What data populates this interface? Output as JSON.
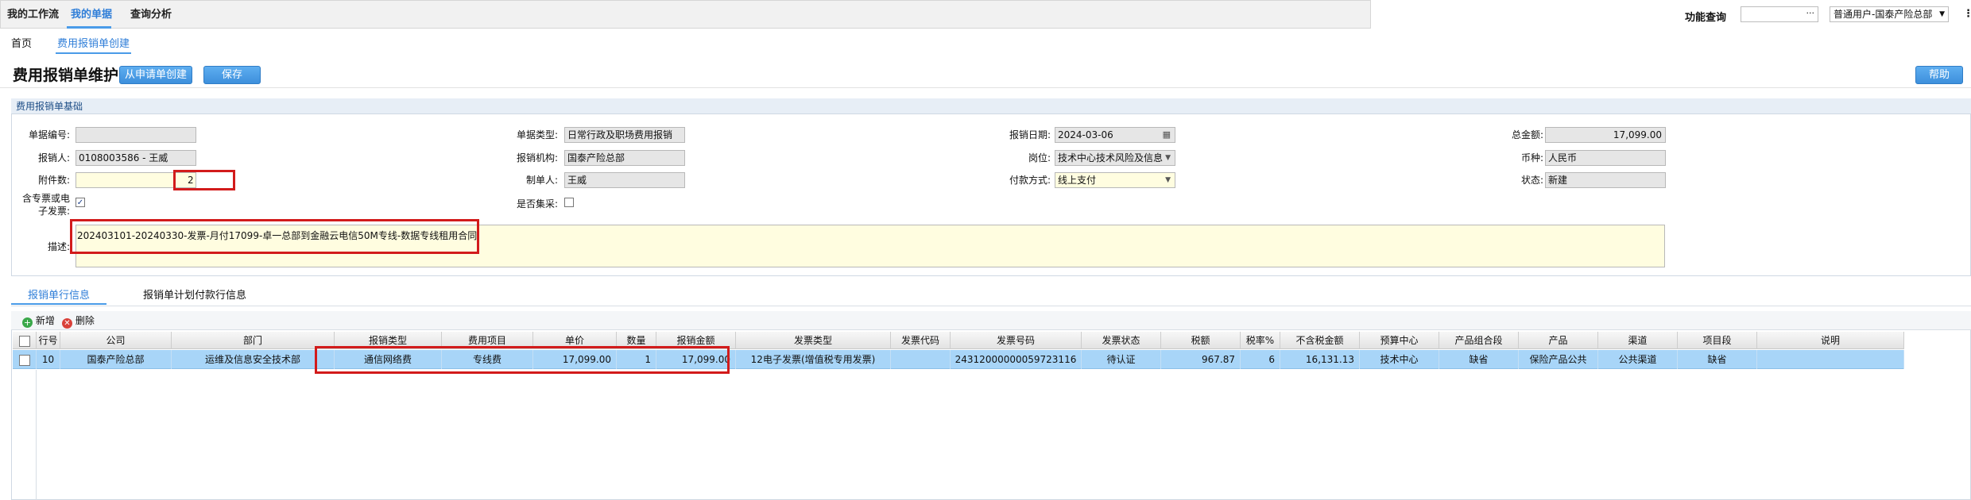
{
  "topnav": {
    "items": [
      "我的工作流",
      "我的单据",
      "查询分析"
    ],
    "function_query": "功能查询",
    "search_value": "···",
    "user_select": "普通用户-国泰产险总部",
    "more": "⋮"
  },
  "breadcrumb_tabs": [
    "首页",
    "费用报销单创建"
  ],
  "header": {
    "title": "费用报销单维护",
    "btn_from_request": "从申请单创建",
    "btn_save": "保存",
    "btn_help": "帮助"
  },
  "panel": {
    "title": "费用报销单基础",
    "fields": {
      "doc_no": {
        "label": "单据编号:",
        "value": ""
      },
      "doc_type": {
        "label": "单据类型:",
        "value": "日常行政及职场费用报销"
      },
      "report_date": {
        "label": "报销日期:",
        "value": "2024-03-06"
      },
      "total": {
        "label": "总金额:",
        "value": "17,099.00"
      },
      "reporter": {
        "label": "报销人:",
        "value": "0108003586 - 王威"
      },
      "org": {
        "label": "报销机构:",
        "value": "国泰产险总部"
      },
      "post": {
        "label": "岗位:",
        "value": "技术中心技术风险及信息"
      },
      "currency": {
        "label": "币种:",
        "value": "人民币"
      },
      "attachments": {
        "label": "附件数:",
        "value": "2"
      },
      "maker": {
        "label": "制单人:",
        "value": "王威"
      },
      "pay_method": {
        "label": "付款方式:",
        "value": "线上支付"
      },
      "status": {
        "label": "状态:",
        "value": "新建"
      },
      "e_invoice": {
        "label": "含专票或电子发票:",
        "checked": true
      },
      "centralized": {
        "label": "是否集采:",
        "checked": false
      },
      "description": {
        "label": "描述:",
        "value": "202403101-20240330-发票-月付17099-卓一总部到金融云电信50M专线-数据专线租用合同"
      }
    }
  },
  "bottom_tabs": [
    "报销单行信息",
    "报销单计划付款行信息"
  ],
  "toolbar": {
    "add": "新增",
    "delete": "删除"
  },
  "grid": {
    "columns": [
      "行号",
      "公司",
      "部门",
      "报销类型",
      "费用项目",
      "单价",
      "数量",
      "报销金额",
      "发票类型",
      "发票代码",
      "发票号码",
      "发票状态",
      "税额",
      "税率%",
      "不含税金额",
      "预算中心",
      "产品组合段",
      "产品",
      "渠道",
      "项目段",
      "说明"
    ],
    "rows": [
      [
        "10",
        "国泰产险总部",
        "运维及信息安全技术部",
        "通信网络费",
        "专线费",
        "17,099.00",
        "1",
        "17,099.00",
        "12电子发票(增值税专用发票)",
        "",
        "24312000000059723116",
        "待认证",
        "967.87",
        "6",
        "16,131.13",
        "技术中心",
        "缺省",
        "保险产品公共",
        "公共渠道",
        "缺省",
        ""
      ]
    ]
  }
}
